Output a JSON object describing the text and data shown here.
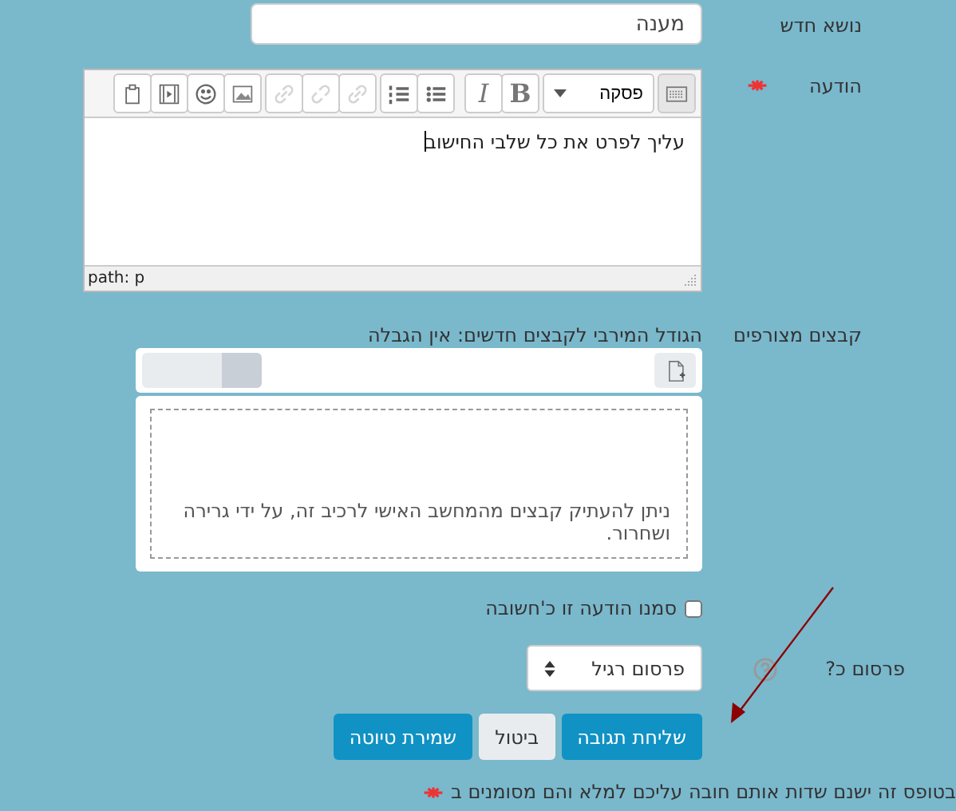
{
  "subject": {
    "label": "נושא חדש",
    "value": "מענה"
  },
  "message": {
    "label": "הודעה",
    "required": true,
    "text": "עליך לפרט את כל שלבי החישוב",
    "path": "path: p",
    "toolbar": [
      {
        "kind": "toggle",
        "disabled": false
      },
      {
        "kind": "format",
        "label": "פסקה",
        "disabled": false
      },
      {
        "kind": "bold",
        "label": "B",
        "disabled": false
      },
      {
        "kind": "italic",
        "label": "I",
        "disabled": false
      },
      {
        "kind": "bullets",
        "disabled": false
      },
      {
        "kind": "numbers",
        "disabled": false
      },
      {
        "kind": "link",
        "disabled": true
      },
      {
        "kind": "unlink",
        "disabled": true
      },
      {
        "kind": "link",
        "disabled": true
      },
      {
        "kind": "image",
        "disabled": false
      },
      {
        "kind": "emoji",
        "disabled": false
      },
      {
        "kind": "media",
        "disabled": false
      },
      {
        "kind": "paste",
        "disabled": false
      }
    ]
  },
  "files": {
    "label": "קבצים מצורפים",
    "max_size": "הגודל המירבי לקבצים חדשים: אין הגבלה",
    "views": [
      {
        "selected": true
      },
      {
        "selected": false
      }
    ],
    "drop_hint": "ניתן להעתיק קבצים מהמחשב האישי לרכיב זה, על ידי גרירה ושחרור."
  },
  "important": {
    "label": "סמנו הודעה זו כ'חשובה",
    "checked": false
  },
  "publish": {
    "label": "פרסום כ?",
    "value": "פרסום רגיל"
  },
  "buttons": [
    {
      "label": "שליחת תגובה",
      "kind": "primary"
    },
    {
      "label": "ביטול",
      "kind": "secondary"
    },
    {
      "label": "שמירת טיוטה",
      "kind": "primary"
    }
  ],
  "footer": {
    "text": "בטופס זה ישנם שדות אותם חובה עליכם למלא והם מסומנים ב",
    "required": true
  }
}
